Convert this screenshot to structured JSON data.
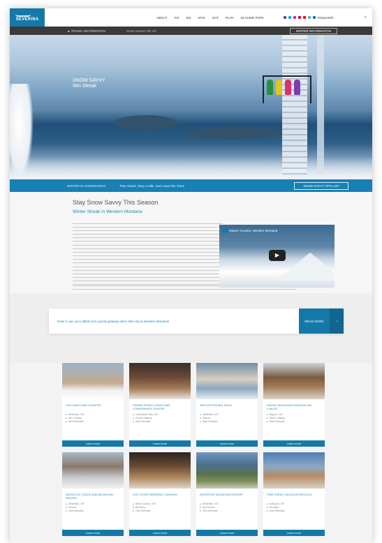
{
  "header": {
    "logo_text": "SEVERINA",
    "nav": [
      "ABOUT",
      "GO",
      "DO",
      "STAY",
      "EAT",
      "PLAN",
      "GLACIER PARK"
    ],
    "social_colors": [
      "#3b5998",
      "#1da1f2",
      "#c32aa3",
      "#e60023",
      "#ff0000",
      "#55acee",
      "#1479a8"
    ],
    "handle": "#GlacierMT"
  },
  "infobar": {
    "alert": "▲ TRAVEL INFORMATION",
    "note": "Snow Season Ski Lift",
    "button": "WINTER INFORMATION"
  },
  "hero": {
    "tagline_1": "SNOW SAVVY",
    "tagline_2": "Win Streak",
    "bar_label": "WINTER IS SNOWSHOES!",
    "bar_text": "Plan Ahead, Stay a Little, and Leave the Trace",
    "bar_button": "SNOW SAVVY TIPS LIST"
  },
  "article": {
    "title": "Stay Snow Savvy This Season",
    "subtitle": "Winter Streak in Western Montana",
    "video_title": "Glacier Country: Western Montana",
    "play_symbol": "▶"
  },
  "cta": {
    "text": "Enter to win up to $500 and a great getaway when take trip to Western Montana!",
    "button": "READ MORE",
    "arrow": "→"
  },
  "cards": [
    {
      "title": "YELLOWSTONE COUNTRY",
      "meta": [
        "Whitefish, MT",
        "Ski Country",
        "Visit Website"
      ],
      "button": "Learn more",
      "img": "linear-gradient(180deg,#9db4c9 0%,#c3a98f 55%,#efefef 75%,#ffffff 100%)"
    },
    {
      "title": "GRAND PEAKS LODGE AND CONFERENCE CENTER",
      "meta": [
        "Columbia Falls, MT",
        "Hotel/Lodging",
        "Visit Website"
      ],
      "button": "Learn more",
      "img": "linear-gradient(180deg,#3a2f2a 0%,#6b4a36 40%,#a47a58 70%,#e9e4de 100%)"
    },
    {
      "title": "RED MOTION BIG ROCK",
      "meta": [
        "Whitefish, MT",
        "Resort",
        "Visit Website"
      ],
      "button": "Learn more",
      "img": "linear-gradient(180deg,#6f8ea8 0%,#d9cfc1 45%,#8aa7bf 70%,#e7ecf1 100%)"
    },
    {
      "title": "SNOWY MOUNTAIN MEADOW SKI CHALET",
      "meta": [
        "Bigfork, MT",
        "Stay Lodging",
        "Visit Website"
      ],
      "button": "Learn more",
      "img": "linear-gradient(180deg,#c9d5df 0%,#7b5b3f 40%,#a27b56 65%,#d8d3cb 100%)"
    },
    {
      "title": "ABSOLUTE LODGE AND MOUNTAIN RESORT",
      "meta": [
        "Whitefish, MT",
        "Resort",
        "Visit Website"
      ],
      "button": "Learn more",
      "img": "linear-gradient(180deg,#a8b8c5 0%,#8a7a6b 40%,#c9cbce 70%,#f1f1f1 100%)"
    },
    {
      "title": "OLD STORE BREWING COMPANY",
      "meta": [
        "West Glacier, MT",
        "Brewery",
        "Visit Website"
      ],
      "button": "Learn more",
      "img": "linear-gradient(180deg,#2b2420 0%,#6e4d34 40%,#b0885e 70%,#e0d7cc 100%)"
    },
    {
      "title": "WHITEFISH MOUNTAIN RESORT",
      "meta": [
        "Whitefish, MT",
        "Ski Resort",
        "Visit Website"
      ],
      "button": "Learn more",
      "img": "linear-gradient(180deg,#6f97bf 0%,#4b6e8c 35%,#58724f 60%,#7f8f5c 80%,#c8cdb8 100%)"
    },
    {
      "title": "PINE CREEK VACATION RENTALS",
      "meta": [
        "Kalispell, MT",
        "Rentals",
        "Visit Website"
      ],
      "button": "Learn more",
      "img": "linear-gradient(180deg,#4f7fb3 0%,#8ca9c6 40%,#b48b63 65%,#d8d1c6 100%)"
    }
  ]
}
